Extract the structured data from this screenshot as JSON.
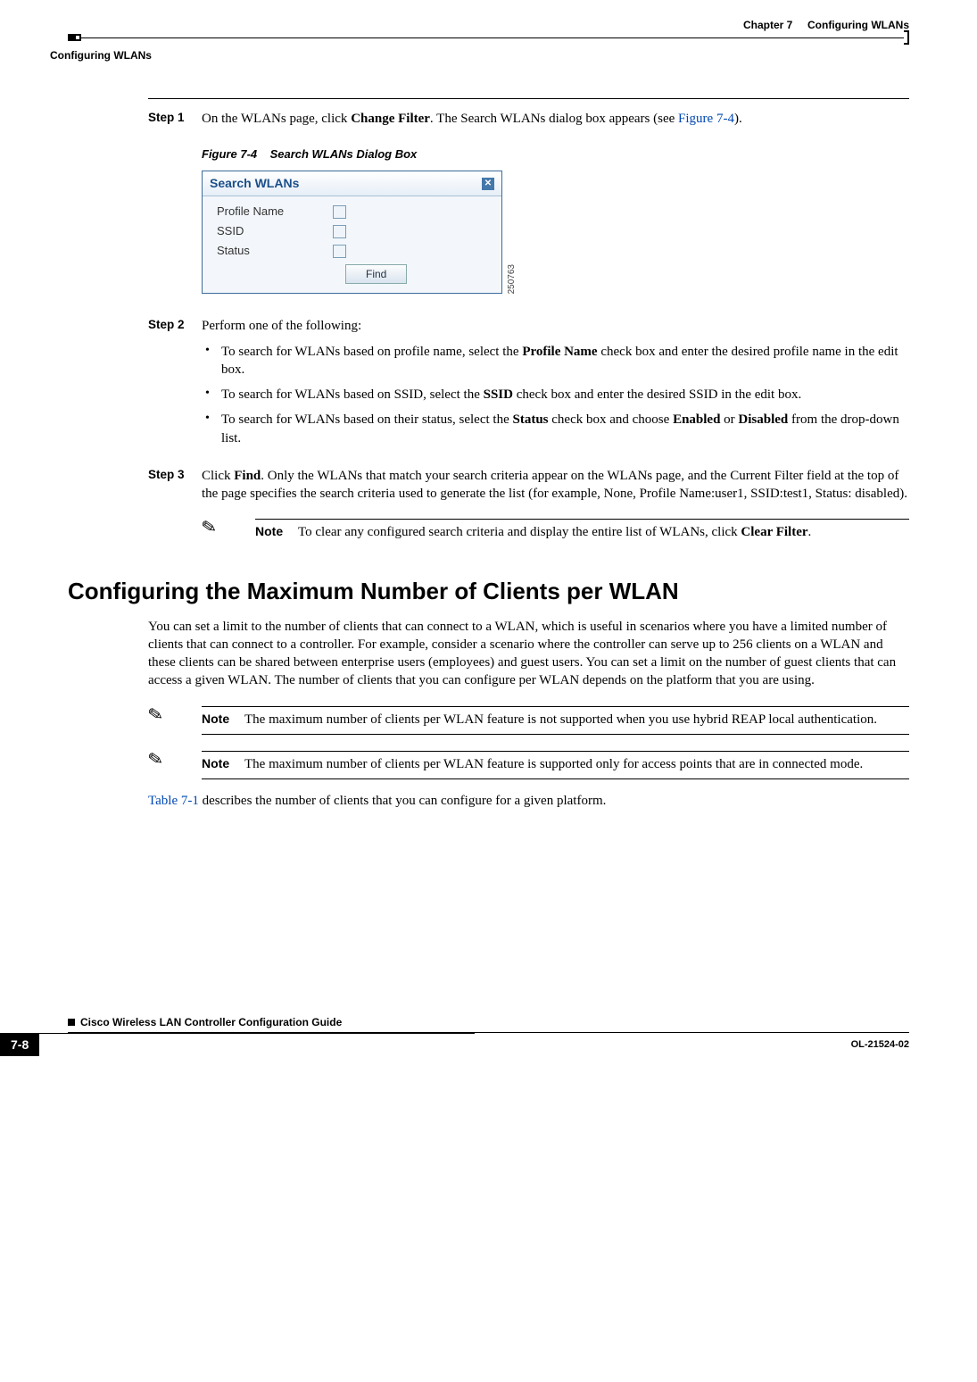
{
  "header": {
    "chapter_label": "Chapter 7",
    "chapter_title": "Configuring WLANs",
    "section_title": "Configuring WLANs"
  },
  "step1": {
    "label": "Step 1",
    "text_pre": "On the WLANs page, click ",
    "bold1": "Change Filter",
    "text_mid": ". The Search WLANs dialog box appears (see ",
    "link": "Figure 7-4",
    "text_post": ")."
  },
  "figure": {
    "caption_num": "Figure 7-4",
    "caption_title": "Search WLANs Dialog Box",
    "img_id": "250763"
  },
  "dialog": {
    "title": "Search WLANs",
    "row_profile": "Profile Name",
    "row_ssid": "SSID",
    "row_status": "Status",
    "find_btn": "Find",
    "close": "✕"
  },
  "step2": {
    "label": "Step 2",
    "lead": "Perform one of the following:",
    "bullet1_pre": "To search for WLANs based on profile name, select the ",
    "bullet1_bold": "Profile Name",
    "bullet1_post": " check box and enter the desired profile name in the edit box.",
    "bullet2_pre": "To search for WLANs based on SSID, select the ",
    "bullet2_bold": "SSID",
    "bullet2_post": " check box and enter the desired SSID in the edit box.",
    "bullet3_pre": "To search for WLANs based on their status, select the ",
    "bullet3_bold1": "Status",
    "bullet3_mid1": " check box and choose ",
    "bullet3_bold2": "Enabled",
    "bullet3_mid2": " or ",
    "bullet3_bold3": "Disabled",
    "bullet3_post": " from the drop-down list."
  },
  "step3": {
    "label": "Step 3",
    "pre": "Click ",
    "bold": "Find",
    "post": ". Only the WLANs that match your search criteria appear on the WLANs page, and the Current Filter field at the top of the page specifies the search criteria used to generate the list (for example, None, Profile Name:user1, SSID:test1, Status: disabled)."
  },
  "note_a": {
    "label": "Note",
    "pre": "To clear any configured search criteria and display the entire list of WLANs, click ",
    "bold": "Clear Filter",
    "post": "."
  },
  "section2": {
    "heading": "Configuring the Maximum Number of Clients per WLAN",
    "para": "You can set a limit to the number of clients that can connect to a WLAN, which is useful in scenarios where you have a limited number of clients that can connect to a controller. For example, consider a scenario where the controller can serve up to 256 clients on a WLAN and these clients can be shared between enterprise users (employees) and guest users. You can set a limit on the number of guest clients that can access a given WLAN. The number of clients that you can configure per WLAN depends on the platform that you are using."
  },
  "note_b": {
    "label": "Note",
    "text": "The maximum number of clients per WLAN feature is not supported when you use hybrid REAP local authentication."
  },
  "note_c": {
    "label": "Note",
    "text": "The maximum number of clients per WLAN feature is supported only for access points that are in connected mode."
  },
  "table_ref": {
    "link": "Table 7-1",
    "post": " describes the number of clients that you can configure for a given platform."
  },
  "footer": {
    "guide_title": "Cisco Wireless LAN Controller Configuration Guide",
    "page_num": "7-8",
    "doc_id": "OL-21524-02"
  }
}
